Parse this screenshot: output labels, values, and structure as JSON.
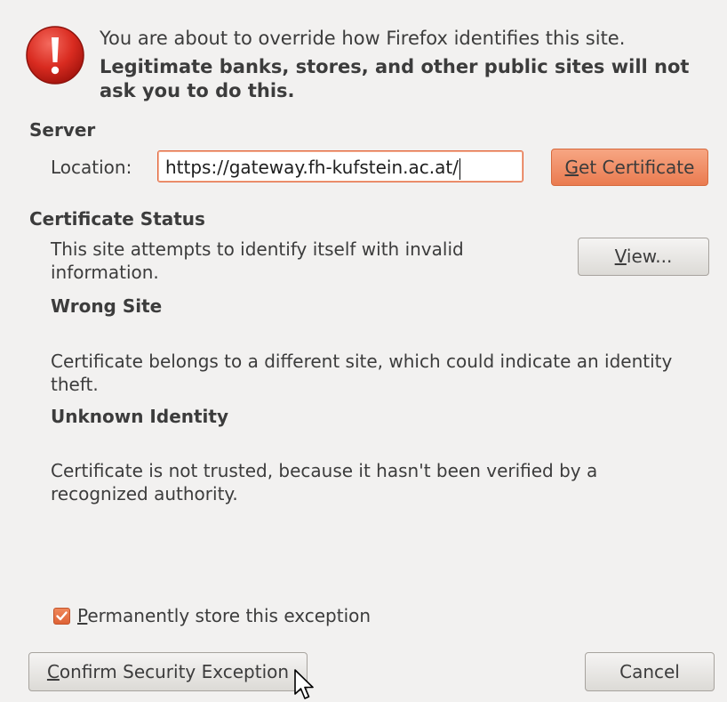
{
  "dialog": {
    "intro_text": "You are about to override how Firefox identifies this site.",
    "warning_text": "Legitimate banks, stores, and other public sites will not ask you to do this."
  },
  "server": {
    "heading": "Server",
    "location_label": "Location:",
    "location_value": "https://gateway.fh-kufstein.ac.at/",
    "get_certificate_button": {
      "mnemonic": "G",
      "rest": "et Certificate"
    }
  },
  "certificate_status": {
    "heading": "Certificate Status",
    "description": "This site attempts to identify itself with invalid information.",
    "view_button": {
      "mnemonic": "V",
      "rest": "iew..."
    },
    "issues": [
      {
        "title": "Wrong Site",
        "detail": "Certificate belongs to a different site, which could indicate an identity theft."
      },
      {
        "title": "Unknown Identity",
        "detail": "Certificate is not trusted, because it hasn't been verified by a recognized authority."
      }
    ]
  },
  "options": {
    "permanent_store": {
      "mnemonic": "P",
      "rest": "ermanently store this exception",
      "checked": true
    }
  },
  "actions": {
    "confirm_button": {
      "mnemonic": "C",
      "rest": "onfirm Security Exception"
    },
    "cancel_button": "Cancel"
  },
  "colors": {
    "accent": "#ea7b50",
    "warning_red": "#d92b20",
    "background": "#f2f1f0"
  },
  "icons": {
    "warning": "exclamation-warning-icon",
    "checkbox_check": "checkmark-icon",
    "cursor": "mouse-pointer-icon"
  }
}
